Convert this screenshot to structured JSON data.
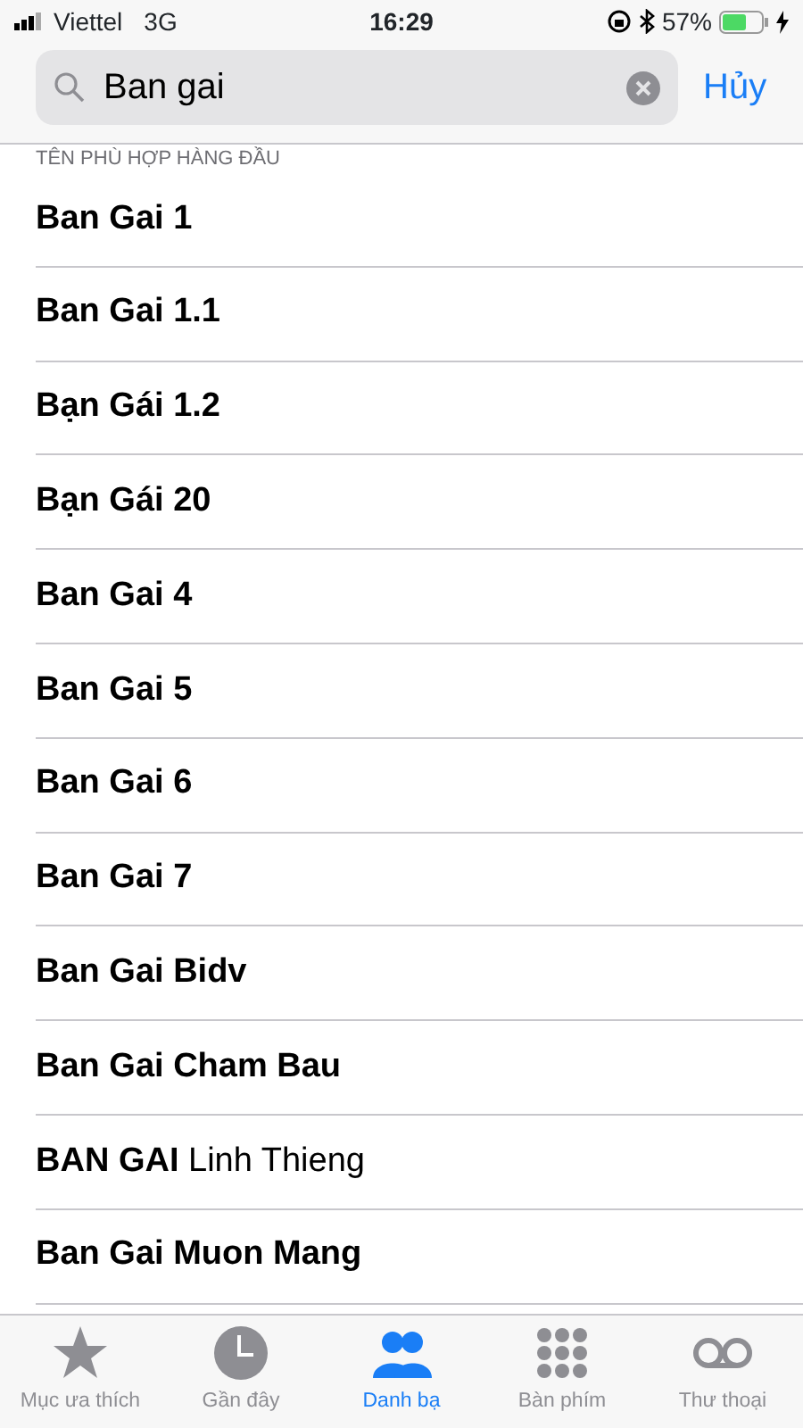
{
  "status_bar": {
    "carrier": "Viettel",
    "network": "3G",
    "time": "16:29",
    "battery_percent": "57%"
  },
  "search": {
    "value": "Ban gai",
    "cancel": "Hủy"
  },
  "section_header": "TÊN PHÙ HỢP HÀNG ĐẦU",
  "contacts": [
    {
      "name": "Ban Gai 1",
      "bold": true
    },
    {
      "name": "Ban Gai 1.1",
      "bold": true
    },
    {
      "name": "Bạn Gái 1.2",
      "bold": true
    },
    {
      "name": "Bạn Gái 20",
      "bold": true
    },
    {
      "name": "Ban Gai 4",
      "bold": true
    },
    {
      "name": "Ban Gai 5",
      "bold": true
    },
    {
      "name": "Ban Gai 6",
      "bold": true
    },
    {
      "name": "Ban Gai 7",
      "bold": true
    },
    {
      "name": "Ban Gai Bidv",
      "bold": true
    },
    {
      "name": "Ban Gai Cham Bau",
      "bold": true
    },
    {
      "name": "**BAN GAI** Linh Thieng",
      "bold": false
    },
    {
      "name": "Ban Gai Muon Mang",
      "bold": true
    }
  ],
  "tabs": [
    {
      "label": "Mục ưa thích",
      "kind": "star",
      "selected": false
    },
    {
      "label": "Gần đây",
      "kind": "clock",
      "selected": false
    },
    {
      "label": "Danh bạ",
      "kind": "people",
      "selected": true
    },
    {
      "label": "Bàn phím",
      "kind": "keypad",
      "selected": false
    },
    {
      "label": "Thư thoại",
      "kind": "voicemail",
      "selected": false
    }
  ]
}
